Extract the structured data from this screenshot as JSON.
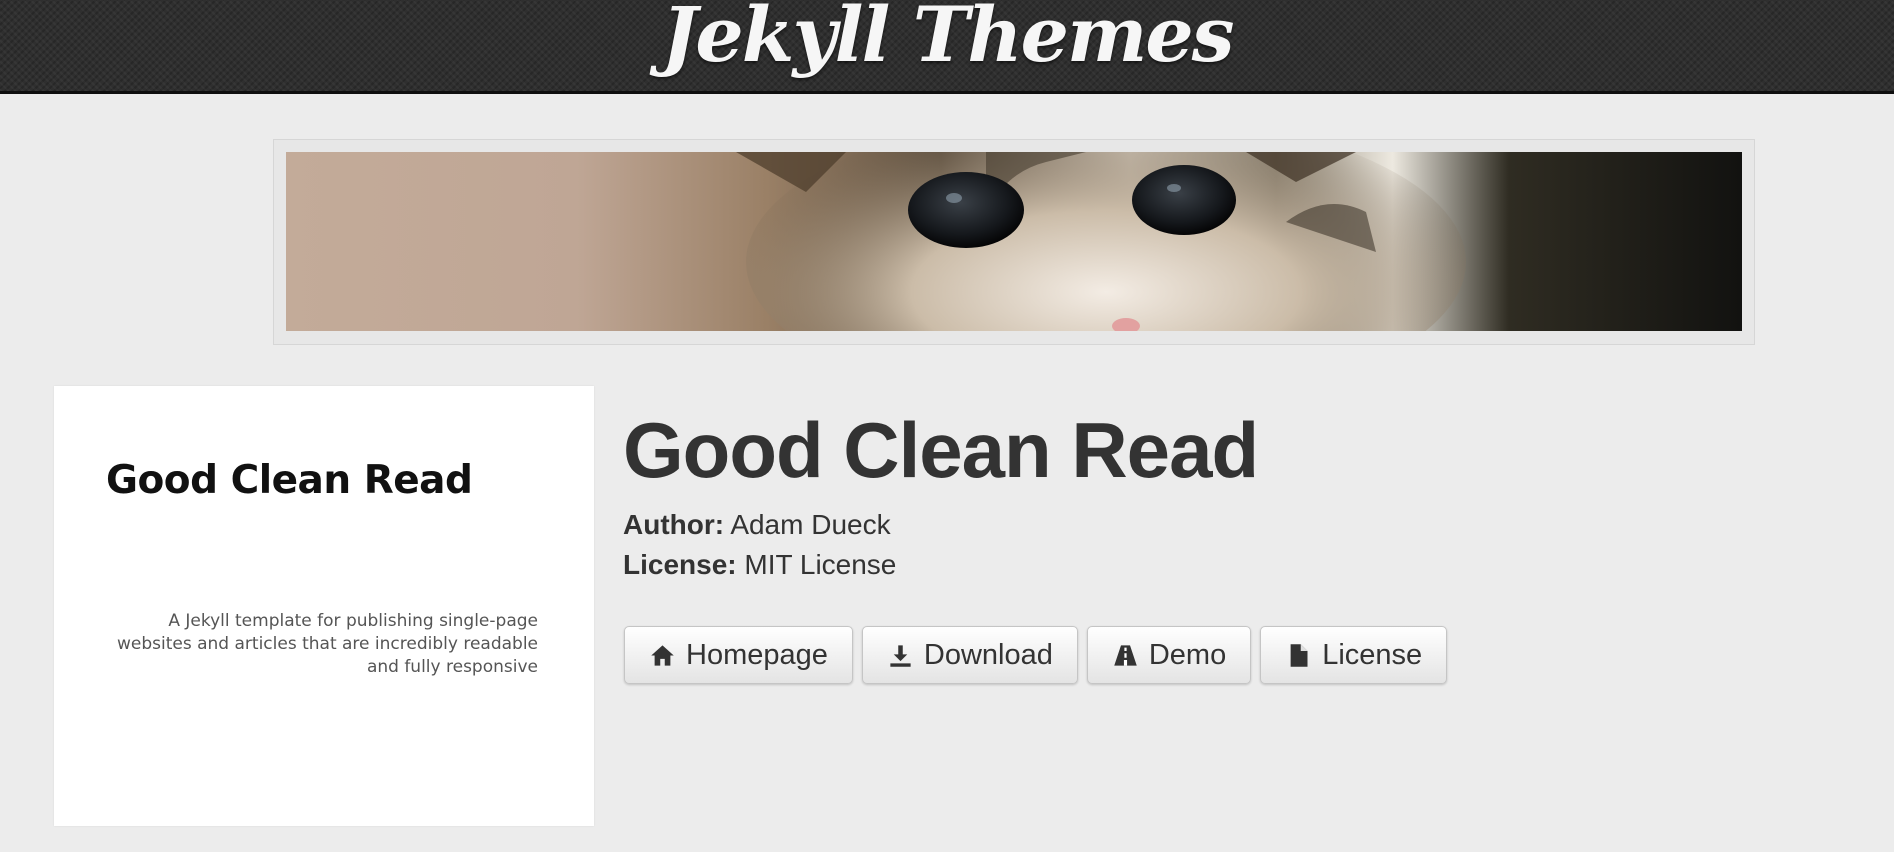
{
  "header": {
    "title": "Jekyll Themes"
  },
  "banner": {
    "image": "kitten-photo"
  },
  "preview": {
    "title": "Good Clean Read",
    "description": "A Jekyll template for publishing single-page websites and articles that are incredibly readable and fully responsive"
  },
  "theme": {
    "name": "Good Clean Read",
    "author_label": "Author:",
    "author": "Adam Dueck",
    "license_label": "License:",
    "license": "MIT License"
  },
  "buttons": [
    {
      "label": "Homepage",
      "icon": "home-icon"
    },
    {
      "label": "Download",
      "icon": "download-icon"
    },
    {
      "label": "Demo",
      "icon": "road-icon"
    },
    {
      "label": "License",
      "icon": "file-icon"
    }
  ],
  "colors": {
    "header_bg": "#2f2f2f",
    "page_bg": "#ececec",
    "text": "#333333"
  }
}
